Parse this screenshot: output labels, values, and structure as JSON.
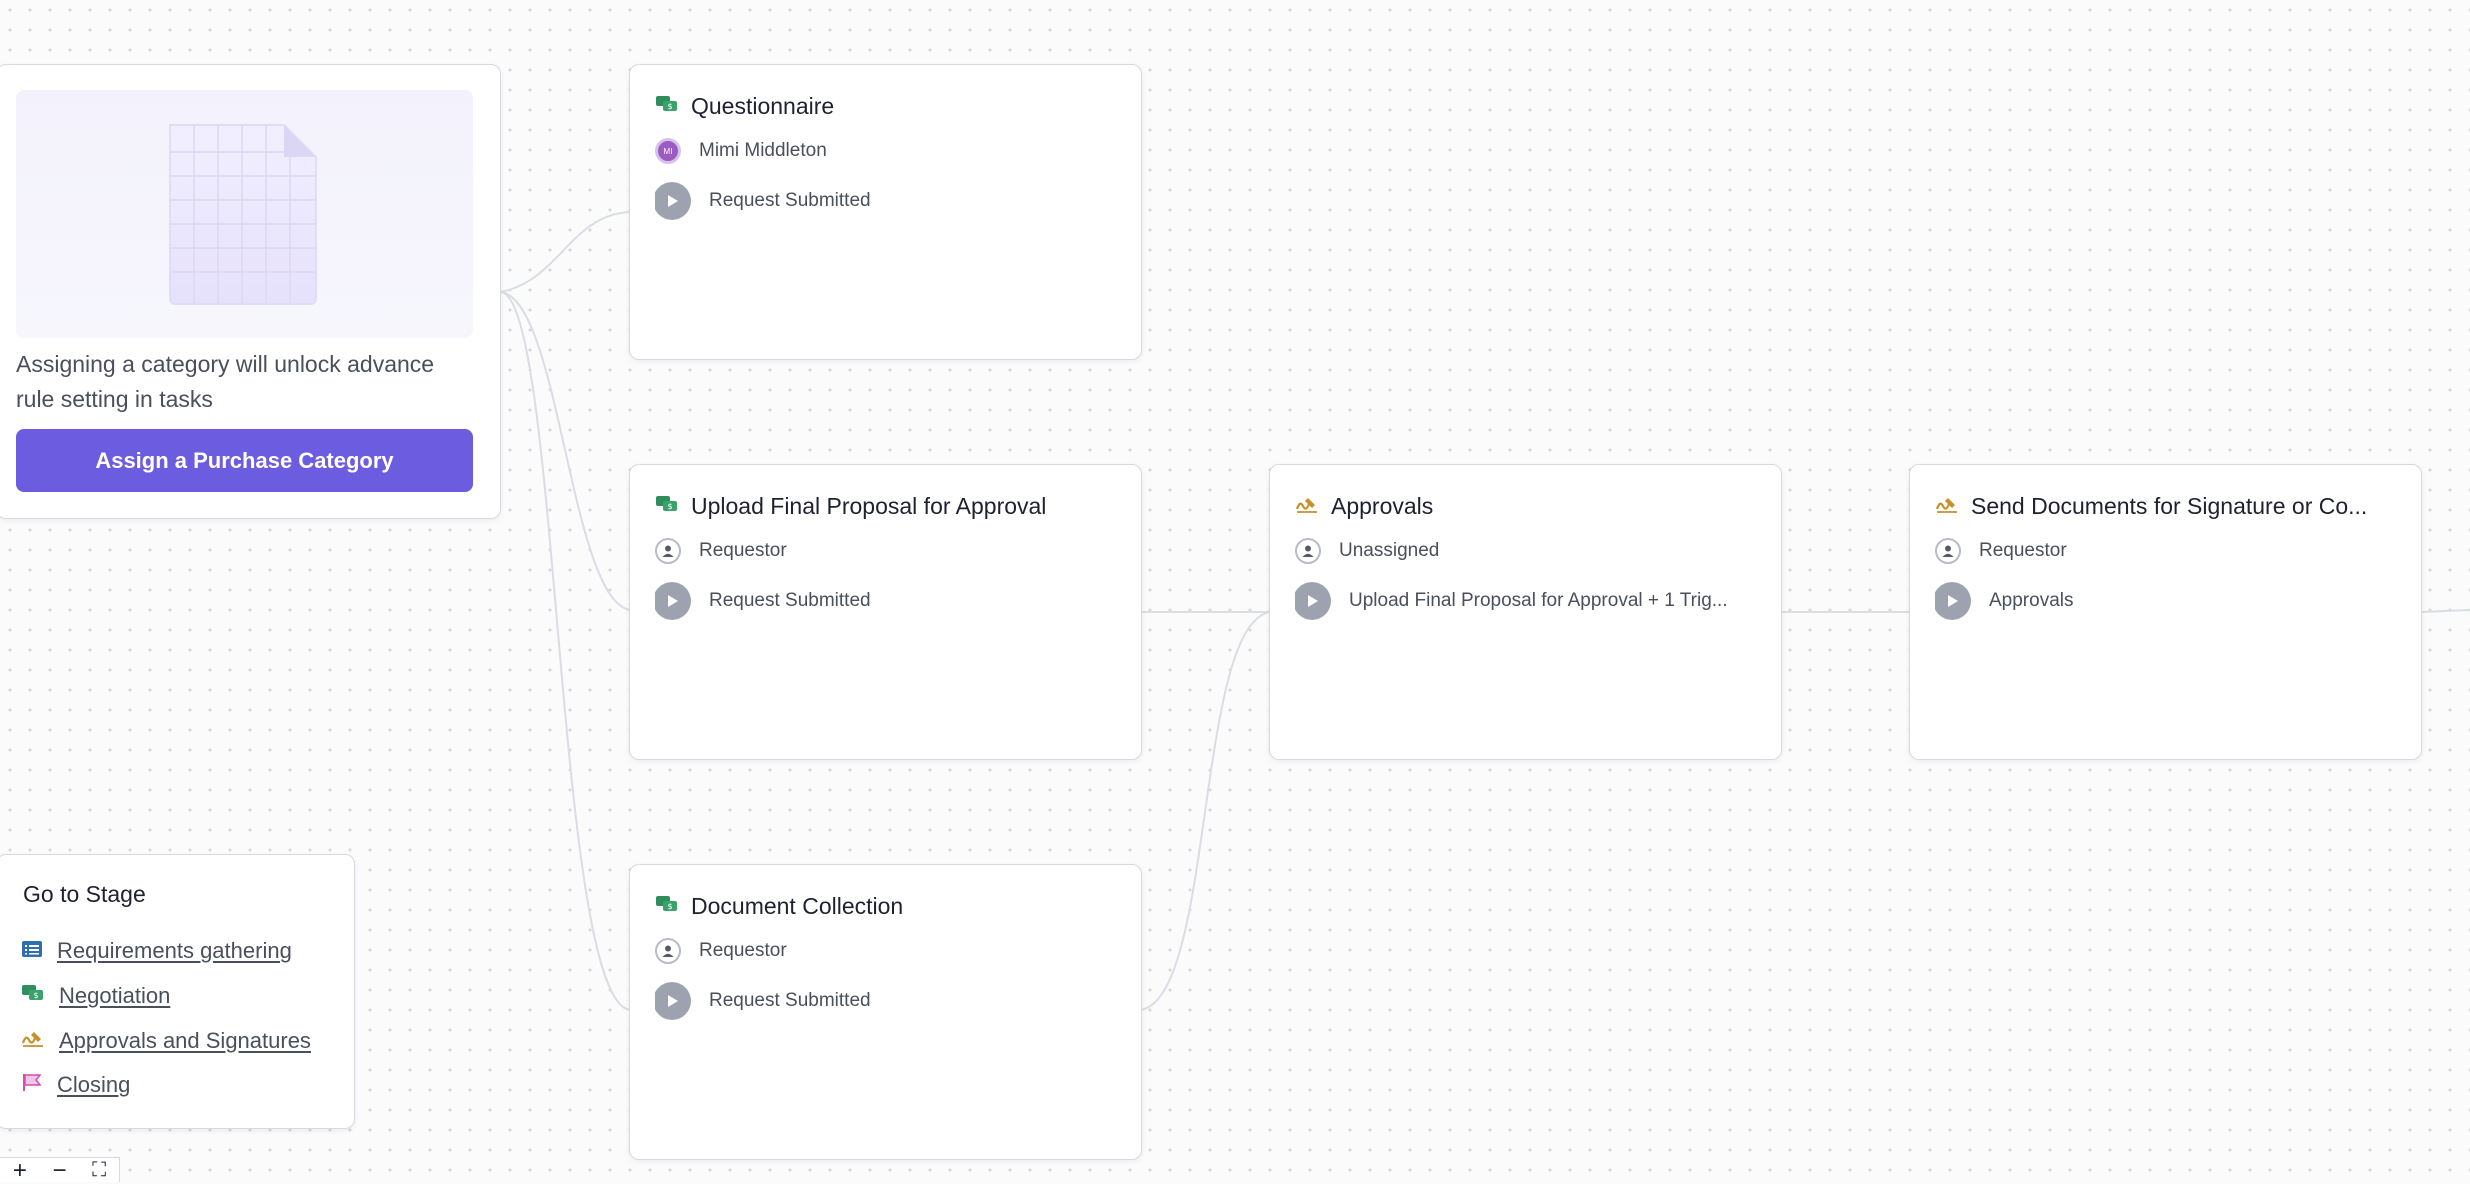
{
  "promo": {
    "description": "Assigning a category will unlock advance rule setting in tasks",
    "button_label": "Assign a Purchase Category"
  },
  "tasks": [
    {
      "title": "Questionnaire",
      "icon": "negotiation-icon",
      "assignee": "Mimi Middleton",
      "avatar_initials": "MI",
      "trigger": "Request Submitted"
    },
    {
      "title": "Upload Final Proposal for Approval",
      "icon": "negotiation-icon",
      "assignee": "Requestor",
      "trigger": "Request Submitted"
    },
    {
      "title": "Document Collection",
      "icon": "negotiation-icon",
      "assignee": "Requestor",
      "trigger": "Request Submitted"
    },
    {
      "title": "Approvals",
      "icon": "signature-icon",
      "assignee": "Unassigned",
      "trigger": "Upload Final Proposal for Approval + 1 Trig..."
    },
    {
      "title": "Send Documents for Signature or Co...",
      "icon": "signature-icon",
      "assignee": "Requestor",
      "trigger": "Approvals"
    }
  ],
  "stage_nav": {
    "heading": "Go to Stage",
    "items": [
      {
        "label": "Requirements gathering",
        "icon": "list-icon"
      },
      {
        "label": "Negotiation",
        "icon": "negotiation-icon"
      },
      {
        "label": "Approvals and Signatures",
        "icon": "signature-icon"
      },
      {
        "label": "Closing",
        "icon": "flag-icon"
      }
    ]
  },
  "zoom": {
    "in": "+",
    "out": "−",
    "fit": "⛶"
  },
  "colors": {
    "accent": "#6b5ce0",
    "negotiation": "#2f8f5b",
    "signature": "#c7902a",
    "list": "#2f6fb0",
    "flag": "#d14fb2"
  }
}
